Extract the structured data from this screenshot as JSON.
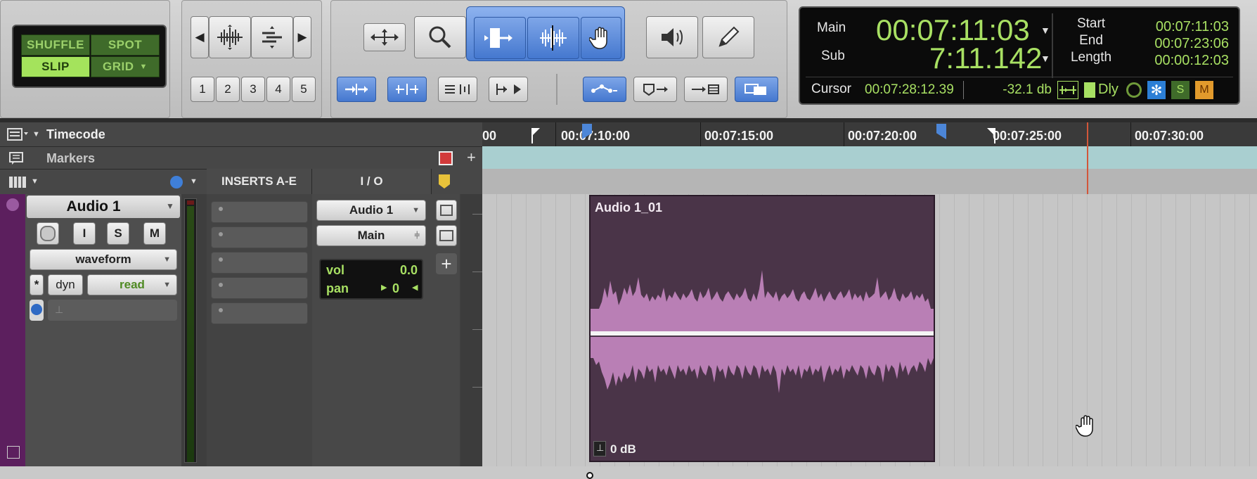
{
  "edit_modes": {
    "shuffle": "SHUFFLE",
    "spot": "SPOT",
    "slip": "SLIP",
    "grid": "GRID"
  },
  "tools": {
    "zoom_presets": [
      "1",
      "2",
      "3",
      "4",
      "5"
    ]
  },
  "counter": {
    "main_label": "Main",
    "main_value": "00:07:11:03",
    "sub_label": "Sub",
    "sub_value": "7:11.142",
    "start_label": "Start",
    "start_value": "00:07:11:03",
    "end_label": "End",
    "end_value": "00:07:23:06",
    "length_label": "Length",
    "length_value": "00:00:12:03",
    "cursor_label": "Cursor",
    "cursor_value": "00:07:28:12.39",
    "db_value": "-32.1 db",
    "dly_label": "Dly",
    "s_label": "S",
    "m_label": "M"
  },
  "rulers": {
    "timecode_label": "Timecode",
    "markers_label": "Markers",
    "timecode_ticks": [
      "00",
      "00:07:10:00",
      "00:07:15:00",
      "00:07:20:00",
      "00:07:25:00",
      "00:07:30:00"
    ]
  },
  "columns": {
    "inserts": "INSERTS A-E",
    "io": "I / O"
  },
  "track": {
    "name": "Audio 1",
    "rec": "",
    "input": "I",
    "solo": "S",
    "mute": "M",
    "view": "waveform",
    "auto_mode": "read",
    "dyn": "dyn",
    "star": "*",
    "io_input": "Audio 1",
    "io_output": "Main",
    "vol_label": "vol",
    "vol_value": "0.0",
    "pan_label": "pan",
    "pan_value": "0"
  },
  "clip": {
    "name": "Audio 1_01",
    "gain": "0 dB"
  },
  "colors": {
    "clip": "#4a3448",
    "waveform": "#c58cc0",
    "ruler": "#3a3a3a",
    "markers_bg": "#a9cfd0",
    "accent_green": "#a8e063"
  }
}
